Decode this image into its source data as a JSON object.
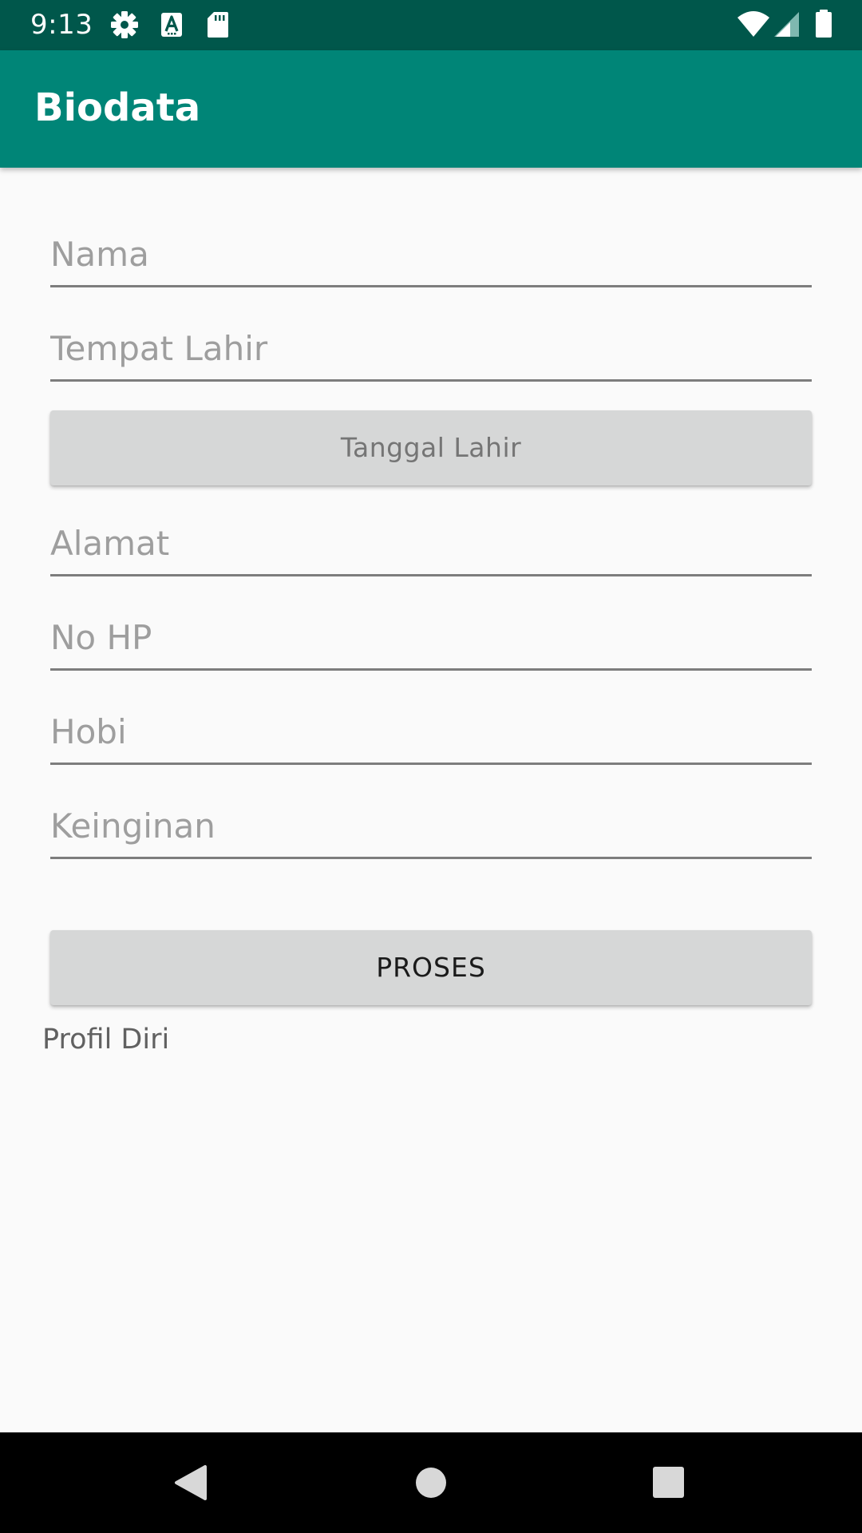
{
  "status_bar": {
    "time": "9:13",
    "icons": [
      "gear-icon",
      "text-a-icon",
      "sd-card-icon",
      "wifi-icon",
      "signal-icon",
      "battery-icon"
    ]
  },
  "app_bar": {
    "title": "Biodata",
    "color": "#008577"
  },
  "form": {
    "nama": {
      "placeholder": "Nama",
      "value": ""
    },
    "tempat_lahir": {
      "placeholder": "Tempat Lahir",
      "value": ""
    },
    "tanggal_lahir_button": "Tanggal Lahir",
    "alamat": {
      "placeholder": "Alamat",
      "value": ""
    },
    "no_hp": {
      "placeholder": "No HP",
      "value": ""
    },
    "hobi": {
      "placeholder": "Hobi",
      "value": ""
    },
    "keinginan": {
      "placeholder": "Keinginan",
      "value": ""
    },
    "proses_button": "PROSES"
  },
  "profile_text": "Profil Diri",
  "nav_bar": {
    "icons": [
      "back-icon",
      "home-icon",
      "recents-icon"
    ]
  }
}
